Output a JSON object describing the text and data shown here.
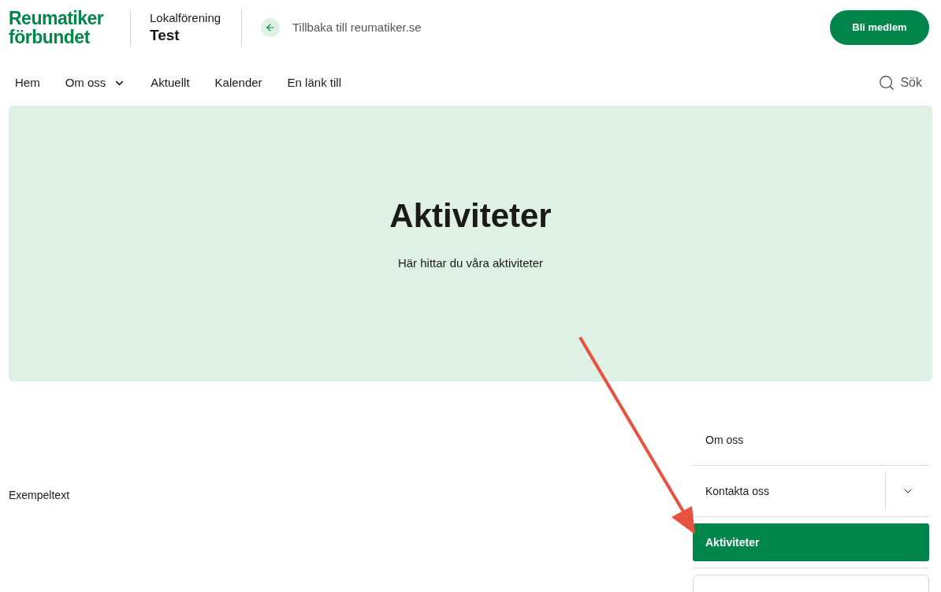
{
  "header": {
    "logo": [
      "Reumatiker",
      "förbundet"
    ],
    "org_label": "Lokalförening",
    "org_name": "Test",
    "back_link": "Tillbaka till reumatiker.se",
    "join_button": "Bli medlem"
  },
  "nav": {
    "items": [
      {
        "label": "Hem",
        "expandable": false
      },
      {
        "label": "Om oss",
        "expandable": true
      },
      {
        "label": "Aktuellt",
        "expandable": false
      },
      {
        "label": "Kalender",
        "expandable": false
      },
      {
        "label": "En länk till",
        "expandable": false
      }
    ],
    "search": "Sök"
  },
  "hero": {
    "title": "Aktiviteter",
    "subtitle": "Här hittar du våra aktiviteter"
  },
  "body_text": "Exempeltext",
  "sidebar": {
    "items": [
      {
        "label": "Om oss",
        "selected": false,
        "expandable": false
      },
      {
        "label": "Kontakta oss",
        "selected": false,
        "expandable": true
      },
      {
        "label": "Aktiviteter",
        "selected": true,
        "expandable": false
      }
    ]
  }
}
